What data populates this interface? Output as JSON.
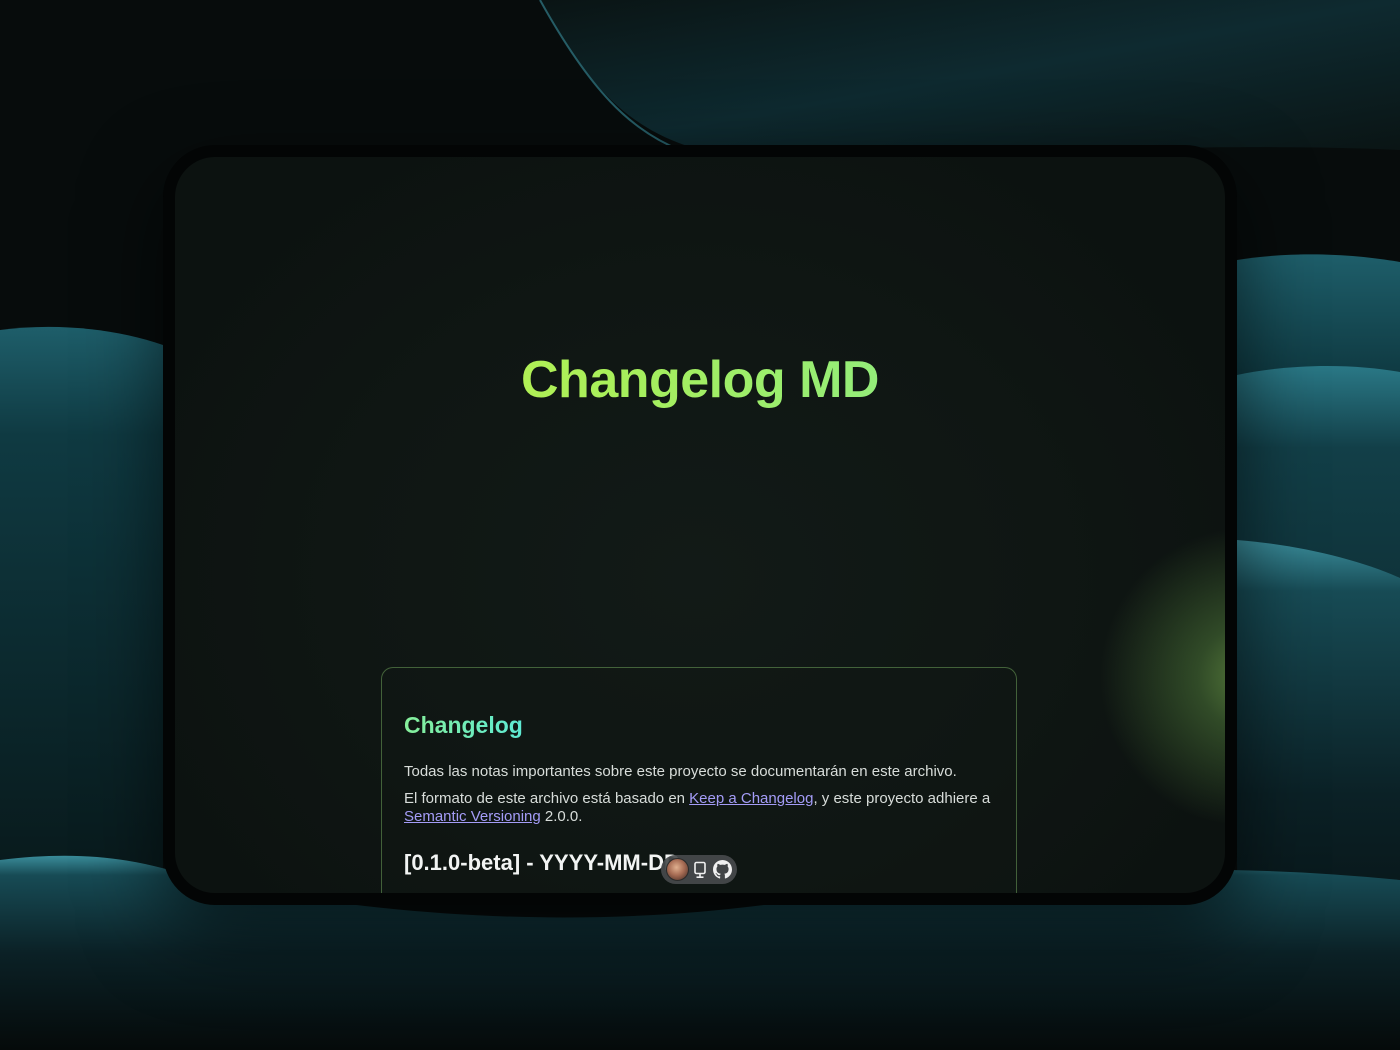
{
  "hero": {
    "title": "Changelog MD"
  },
  "card": {
    "title": "Changelog",
    "paragraph1": "Todas las notas importantes sobre este proyecto se documentarán en este archivo.",
    "paragraph2_before": "El formato de este archivo está basado en ",
    "link1_label": "Keep a Changelog",
    "paragraph2_middle": ", y este proyecto adhiere a ",
    "link2_label": "Semantic Versioning",
    "paragraph2_after": " 2.0.0.",
    "version_heading": "[0.1.0-beta] - YYYY-MM-DD"
  },
  "toolbar": {
    "icons": [
      "avatar",
      "device-icon",
      "github-icon"
    ]
  },
  "colors": {
    "title_gradient_start": "#e4f536",
    "title_gradient_end": "#6ee7b7",
    "link": "#a49cf7",
    "card_border": "#6ea05a"
  }
}
